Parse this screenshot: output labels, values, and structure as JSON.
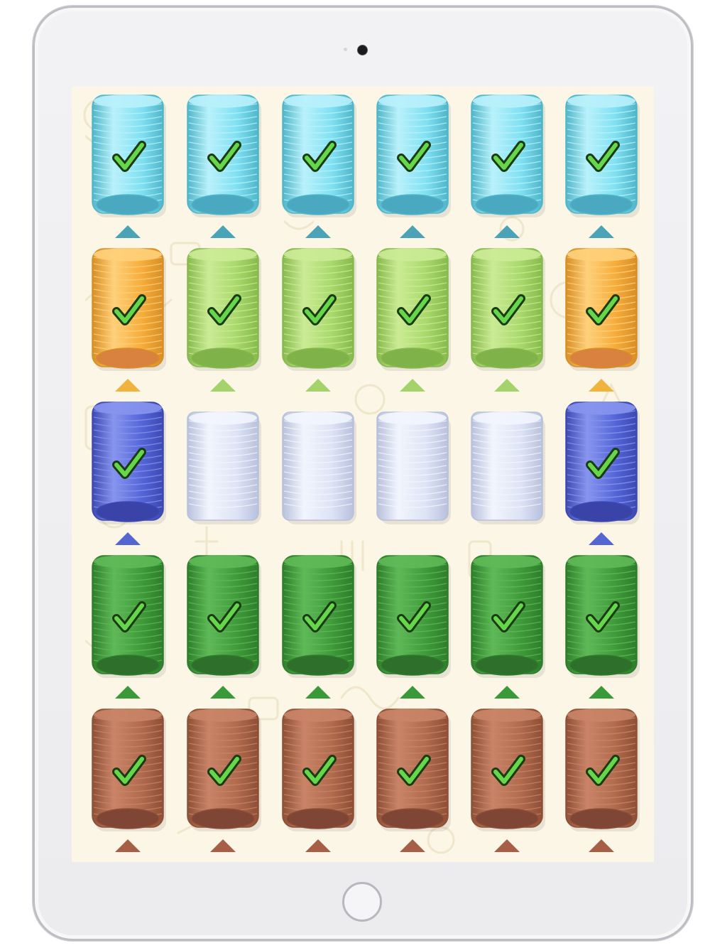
{
  "game": {
    "title": "",
    "columns": 6,
    "rows": 5
  },
  "palette": {
    "cyan": {
      "body": "#7fe0f2",
      "light": "#b9f1fb",
      "rim": "#4fb5c8",
      "base": "#4aa9c0",
      "arrow": "#4ba3b8"
    },
    "orange": {
      "body": "#f7ac3a",
      "light": "#ffd07a",
      "rim": "#d88e26",
      "base": "#d98240",
      "arrow": "#f0b43e"
    },
    "lime": {
      "body": "#a8d86b",
      "light": "#cbeb95",
      "rim": "#86b94d",
      "base": "#7fb349",
      "arrow": "#a4d36b"
    },
    "blue": {
      "body": "#5465d8",
      "light": "#8795ee",
      "rim": "#3d49b2",
      "base": "#3a44a8",
      "arrow": "#5566d3"
    },
    "white": {
      "body": "#dde3f5",
      "light": "#f2f5fd",
      "rim": "#b8c0dc",
      "base": "#c9d0ea",
      "arrow": "none"
    },
    "green": {
      "body": "#3f9a3a",
      "light": "#5fb957",
      "rim": "#2e7d2b",
      "base": "#2d6f2b",
      "arrow": "#3a9938"
    },
    "brown": {
      "body": "#b06a4d",
      "light": "#c98467",
      "rim": "#8d4f36",
      "base": "#7f4535",
      "arrow": "#a65e45"
    }
  },
  "board": [
    [
      "cyan",
      "cyan",
      "cyan",
      "cyan",
      "cyan",
      "cyan"
    ],
    [
      "orange",
      "lime",
      "lime",
      "lime",
      "lime",
      "orange"
    ],
    [
      "blue",
      "white",
      "white",
      "white",
      "white",
      "blue"
    ],
    [
      "green",
      "green",
      "green",
      "green",
      "green",
      "green"
    ],
    [
      "brown",
      "brown",
      "brown",
      "brown",
      "brown",
      "brown"
    ]
  ],
  "completed": [
    [
      true,
      true,
      true,
      true,
      true,
      true
    ],
    [
      true,
      true,
      true,
      true,
      true,
      true
    ],
    [
      true,
      false,
      false,
      false,
      false,
      true
    ],
    [
      true,
      true,
      true,
      true,
      true,
      true
    ],
    [
      true,
      true,
      true,
      true,
      true,
      true
    ]
  ],
  "icons": {
    "check": "check-icon",
    "arrow": "up-arrow-icon"
  }
}
